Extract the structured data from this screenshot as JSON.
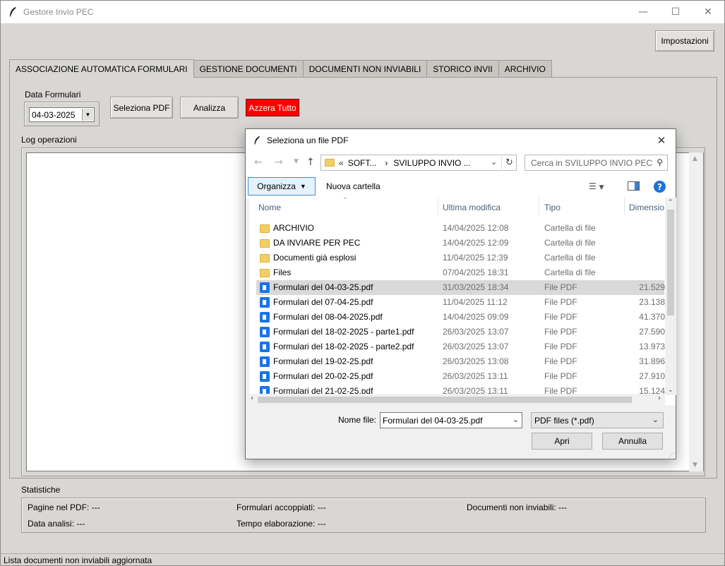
{
  "window": {
    "title": "Gestore Invio PEC"
  },
  "header": {
    "settings_label": "Impostazioni"
  },
  "tabs": [
    {
      "label": "ASSOCIAZIONE AUTOMATICA FORMULARI",
      "active": true
    },
    {
      "label": "GESTIONE DOCUMENTI",
      "active": false
    },
    {
      "label": "DOCUMENTI NON INVIABILI",
      "active": false
    },
    {
      "label": "STORICO INVII",
      "active": false
    },
    {
      "label": "ARCHIVIO",
      "active": false
    }
  ],
  "controls": {
    "date_label": "Data Formulari",
    "date_value": "04-03-2025",
    "select_pdf_label": "Seleziona PDF",
    "analyze_label": "Analizza",
    "reset_label": "Azzera Tutto"
  },
  "log": {
    "label": "Log operazioni"
  },
  "stats": {
    "label": "Statistiche",
    "pages": "Pagine nel PDF: ---",
    "paired": "Formulari accoppiati: ---",
    "non_sendable": "Documenti non inviabili: ---",
    "analysis_date": "Data analisi: ---",
    "processing_time": "Tempo elaborazione: ---"
  },
  "status_bar": "Lista documenti non inviabili aggiornata",
  "dialog": {
    "title": "Seleziona un file PDF",
    "address": {
      "prefix": "«",
      "part1": "SOFT...",
      "separator": "›",
      "part2": "SVILUPPO INVIO ..."
    },
    "search_placeholder": "Cerca in SVILUPPO INVIO PEC",
    "organize_label": "Organizza",
    "new_folder_label": "Nuova cartella",
    "columns": {
      "name": "Nome",
      "modified": "Ultima modifica",
      "type": "Tipo",
      "size": "Dimensio"
    },
    "files": [
      {
        "name": "ARCHIVIO",
        "modified": "14/04/2025 12:08",
        "type": "Cartella di file",
        "size": "",
        "kind": "folder"
      },
      {
        "name": "DA INVIARE PER PEC",
        "modified": "14/04/2025 12:09",
        "type": "Cartella di file",
        "size": "",
        "kind": "folder"
      },
      {
        "name": "Documenti già esplosi",
        "modified": "11/04/2025 12:39",
        "type": "Cartella di file",
        "size": "",
        "kind": "folder"
      },
      {
        "name": "Files",
        "modified": "07/04/2025 18:31",
        "type": "Cartella di file",
        "size": "",
        "kind": "folder"
      },
      {
        "name": "Formulari del 04-03-25.pdf",
        "modified": "31/03/2025 18:34",
        "type": "File PDF",
        "size": "21.529",
        "kind": "pdf",
        "selected": true
      },
      {
        "name": "Formulari del 07-04-25.pdf",
        "modified": "11/04/2025 11:12",
        "type": "File PDF",
        "size": "23.138",
        "kind": "pdf"
      },
      {
        "name": "Formulari del 08-04-2025.pdf",
        "modified": "14/04/2025 09:09",
        "type": "File PDF",
        "size": "41.370",
        "kind": "pdf"
      },
      {
        "name": "Formulari del 18-02-2025 - parte1.pdf",
        "modified": "26/03/2025 13:07",
        "type": "File PDF",
        "size": "27.590",
        "kind": "pdf"
      },
      {
        "name": "Formulari del 18-02-2025 - parte2.pdf",
        "modified": "26/03/2025 13:07",
        "type": "File PDF",
        "size": "13.973",
        "kind": "pdf"
      },
      {
        "name": "Formulari del 19-02-25.pdf",
        "modified": "26/03/2025 13:08",
        "type": "File PDF",
        "size": "31.896",
        "kind": "pdf"
      },
      {
        "name": "Formulari del 20-02-25.pdf",
        "modified": "26/03/2025 13:11",
        "type": "File PDF",
        "size": "27.910",
        "kind": "pdf"
      },
      {
        "name": "Formulari del 21-02-25.pdf",
        "modified": "26/03/2025 13:11",
        "type": "File PDF",
        "size": "15.124",
        "kind": "pdf"
      }
    ],
    "filename_label": "Nome file:",
    "filename_value": "Formulari del 04-03-25.pdf",
    "filter_value": "PDF files (*.pdf)",
    "open_label": "Apri",
    "cancel_label": "Annulla"
  },
  "colors": {
    "reset_button": "#ff0000",
    "selected_row": "#d9d9d9",
    "help_icon": "#1e6fd9"
  }
}
